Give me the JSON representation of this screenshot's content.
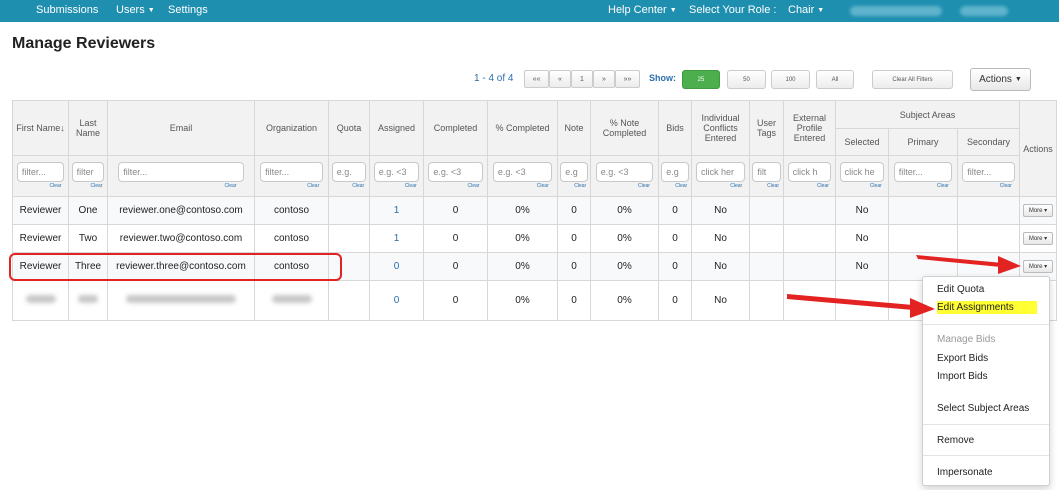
{
  "nav": {
    "submissions": "Submissions",
    "users": "Users",
    "settings": "Settings",
    "help_center": "Help Center",
    "select_role_label": "Select Your Role :",
    "role": "Chair"
  },
  "page_title": "Manage Reviewers",
  "pager": {
    "range_text": "1 - 4 of 4",
    "buttons": [
      "««",
      "«",
      "1",
      "»",
      "»»"
    ],
    "show_label": "Show:",
    "show_options": [
      "25",
      "50",
      "100",
      "All"
    ],
    "show_selected": "25",
    "clear_filters": "Clear All Filters",
    "actions_label": "Actions"
  },
  "table": {
    "headers": {
      "first_name": "First Name",
      "last_name": "Last Name",
      "email": "Email",
      "organization": "Organization",
      "quota": "Quota",
      "assigned": "Assigned",
      "completed": "Completed",
      "pct_completed": "% Completed",
      "note": "Note",
      "pct_note_completed": "% Note Completed",
      "bids": "Bids",
      "individual_conflicts": "Individual Conflicts Entered",
      "user_tags": "User Tags",
      "external_profile": "External Profile Entered",
      "subject_areas": "Subject Areas",
      "selected": "Selected",
      "primary": "Primary",
      "secondary": "Secondary",
      "actions": "Actions"
    },
    "filters": {
      "first_name": "filter...",
      "last_name": "filter",
      "email": "filter...",
      "organization": "filter...",
      "quota": "e.g.",
      "assigned": "e.g. <3",
      "completed": "e.g. <3",
      "pct_completed": "e.g. <3",
      "note": "e.g",
      "pct_note_completed": "e.g. <3",
      "bids": "e.g",
      "individual_conflicts": "click her",
      "user_tags": "filt",
      "external_profile": "click h",
      "selected": "click he",
      "primary": "filter...",
      "secondary": "filter...",
      "clear_label": "Clear"
    },
    "rows": [
      {
        "first": "Reviewer",
        "last": "One",
        "email": "reviewer.one@contoso.com",
        "org": "contoso",
        "quota": "",
        "assigned": "1",
        "completed": "0",
        "pct_completed": "0%",
        "note": "0",
        "pct_note": "0%",
        "bids": "0",
        "conflicts": "No",
        "tags": "",
        "external": "",
        "selected": "No",
        "primary": "",
        "secondary": "",
        "more": "More"
      },
      {
        "first": "Reviewer",
        "last": "Two",
        "email": "reviewer.two@contoso.com",
        "org": "contoso",
        "quota": "",
        "assigned": "1",
        "completed": "0",
        "pct_completed": "0%",
        "note": "0",
        "pct_note": "0%",
        "bids": "0",
        "conflicts": "No",
        "tags": "",
        "external": "",
        "selected": "No",
        "primary": "",
        "secondary": "",
        "more": "More"
      },
      {
        "first": "Reviewer",
        "last": "Three",
        "email": "reviewer.three@contoso.com",
        "org": "contoso",
        "quota": "",
        "assigned": "0",
        "completed": "0",
        "pct_completed": "0%",
        "note": "0",
        "pct_note": "0%",
        "bids": "0",
        "conflicts": "No",
        "tags": "",
        "external": "",
        "selected": "No",
        "primary": "",
        "secondary": "",
        "more": "More"
      },
      {
        "assigned": "0",
        "completed": "0",
        "pct_completed": "0%",
        "note": "0",
        "pct_note": "0%",
        "bids": "0",
        "conflicts": "No"
      }
    ]
  },
  "dropdown": {
    "items": [
      "Edit Quota",
      "Edit Assignments",
      "Manage Bids",
      "Export Bids",
      "Import Bids",
      "Select Subject Areas",
      "Remove",
      "Impersonate"
    ],
    "highlighted": "Edit Assignments",
    "disabled": "Manage Bids"
  },
  "colors": {
    "nav_bg": "#1f8fb0",
    "link": "#2a6fae",
    "active_green": "#4cae4c",
    "annotation_red": "#e32222",
    "highlight_yellow": "#ffff33"
  }
}
